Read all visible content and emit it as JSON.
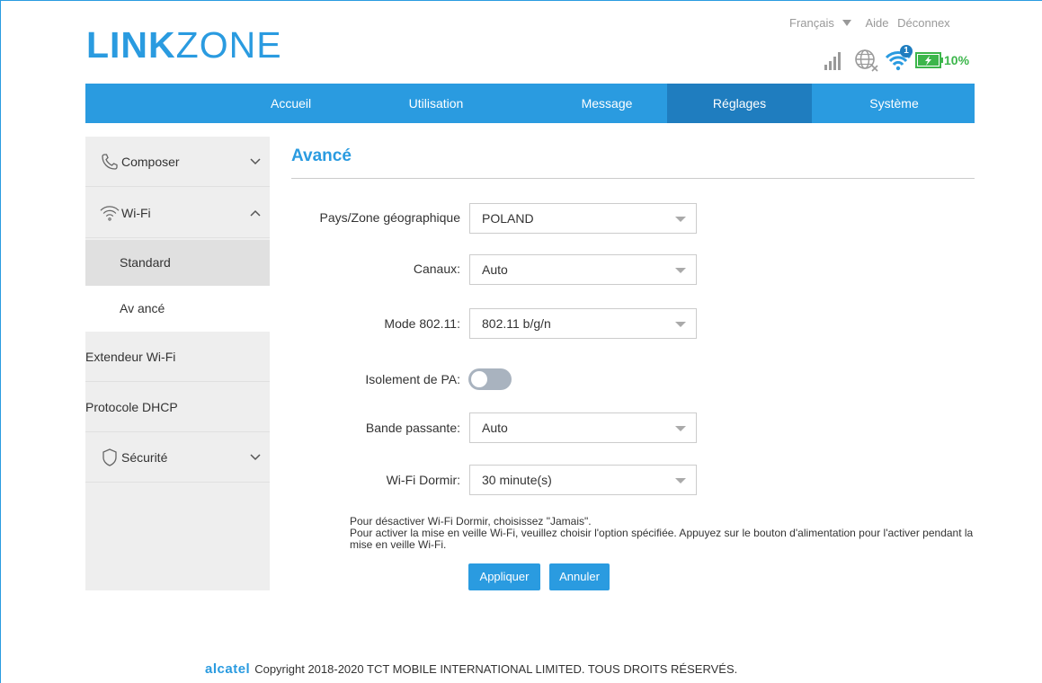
{
  "header": {
    "logo_bold": "LINK",
    "logo_light": "ZONE",
    "language": "Français",
    "help": "Aide",
    "logout": "Déconnex",
    "battery_percent": "10%",
    "wifi_clients": "1",
    "accent_color": "#2a9be0",
    "battery_color": "#3cb64b",
    "icons": [
      "signal-icon",
      "globe-no-internet-icon",
      "wifi-icon",
      "battery-charging-icon"
    ]
  },
  "nav": {
    "items": [
      {
        "label": "Accueil"
      },
      {
        "label": "Utilisation"
      },
      {
        "label": "Message"
      },
      {
        "label": "Réglages"
      },
      {
        "label": "Système"
      }
    ],
    "active": "Réglages"
  },
  "sidebar": {
    "composer": "Composer",
    "wifi": "Wi-Fi",
    "standard": "Standard",
    "avance": "Av ancé",
    "extender": "Extendeur Wi-Fi",
    "dhcp": "Protocole DHCP",
    "security": "Sécurité"
  },
  "main": {
    "title": "Avancé",
    "country_label": "Pays/Zone géographique",
    "country_value": "POLAND",
    "channels_label": "Canaux:",
    "channels_value": "Auto",
    "mode_label": "Mode 802.11:",
    "mode_value": "802.11 b/g/n",
    "ap_isolation_label": "Isolement de PA:",
    "ap_isolation_on": false,
    "bandwidth_label": "Bande passante:",
    "bandwidth_value": "Auto",
    "sleep_label": "Wi-Fi Dormir:",
    "sleep_value": "30 minute(s)",
    "note1": "Pour désactiver Wi-Fi Dormir, choisissez \"Jamais\".",
    "note2": "Pour activer la mise en veille Wi-Fi, veuillez choisir l'option spécifiée. Appuyez sur le bouton d'alimentation pour l'activer pendant la mise en veille Wi-Fi.",
    "apply": "Appliquer",
    "cancel": "Annuler"
  },
  "footer": {
    "brand": "alcatel",
    "copyright": "Copyright 2018-2020 TCT MOBILE INTERNATIONAL LIMITED. TOUS DROITS RÉSERVÉS."
  }
}
